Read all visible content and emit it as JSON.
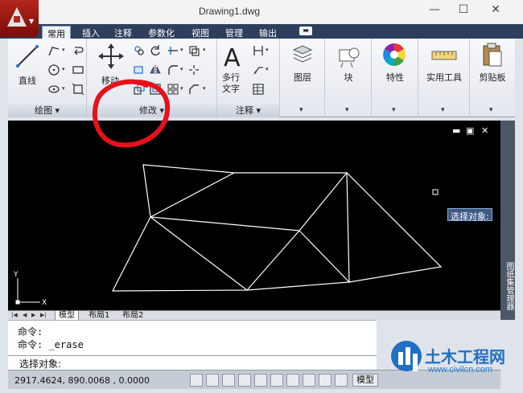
{
  "window": {
    "title": "Drawing1.dwg",
    "controls": [
      "—",
      "☐",
      "✕"
    ]
  },
  "tabs": [
    {
      "label": "常用",
      "active": true
    },
    {
      "label": "插入"
    },
    {
      "label": "注释"
    },
    {
      "label": "参数化"
    },
    {
      "label": "视图"
    },
    {
      "label": "管理"
    },
    {
      "label": "输出"
    }
  ],
  "ribbon": {
    "draw": {
      "line_label": "直线",
      "footer": "绘图 ▾"
    },
    "modify": {
      "move_label": "移动",
      "footer": "修改 ▾"
    },
    "annotate": {
      "text_label_1": "多行",
      "text_label_2": "文字",
      "footer": "注释 ▾"
    },
    "layers": {
      "label": "图层"
    },
    "block": {
      "label": "块"
    },
    "properties": {
      "label": "特性"
    },
    "utilities": {
      "label": "实用工具"
    },
    "clipboard": {
      "label": "剪贴板"
    }
  },
  "viewport": {
    "controls": [
      "▬",
      "▣",
      "✕"
    ],
    "prompt_tooltip": "选择对象:",
    "ucs_x": "X",
    "ucs_y": "Y"
  },
  "side_panel": {
    "label": "图纸集管理器"
  },
  "layout_tabs": [
    {
      "label": "模型",
      "active": true
    },
    {
      "label": "布局1"
    },
    {
      "label": "布局2"
    }
  ],
  "command": {
    "history": [
      "命令:",
      "命令:  _erase"
    ],
    "prompt": "选择对象:"
  },
  "status": {
    "coordinates": "2917.4624, 890.0068 , 0.0000",
    "model_label": "模型"
  },
  "watermark": {
    "title": "土木工程网",
    "url": "www.civilcn.com"
  },
  "colors": {
    "ribbon_tab_bg": "#2d3f5c",
    "canvas_bg": "#000000",
    "annotation_red": "#e8101a"
  }
}
